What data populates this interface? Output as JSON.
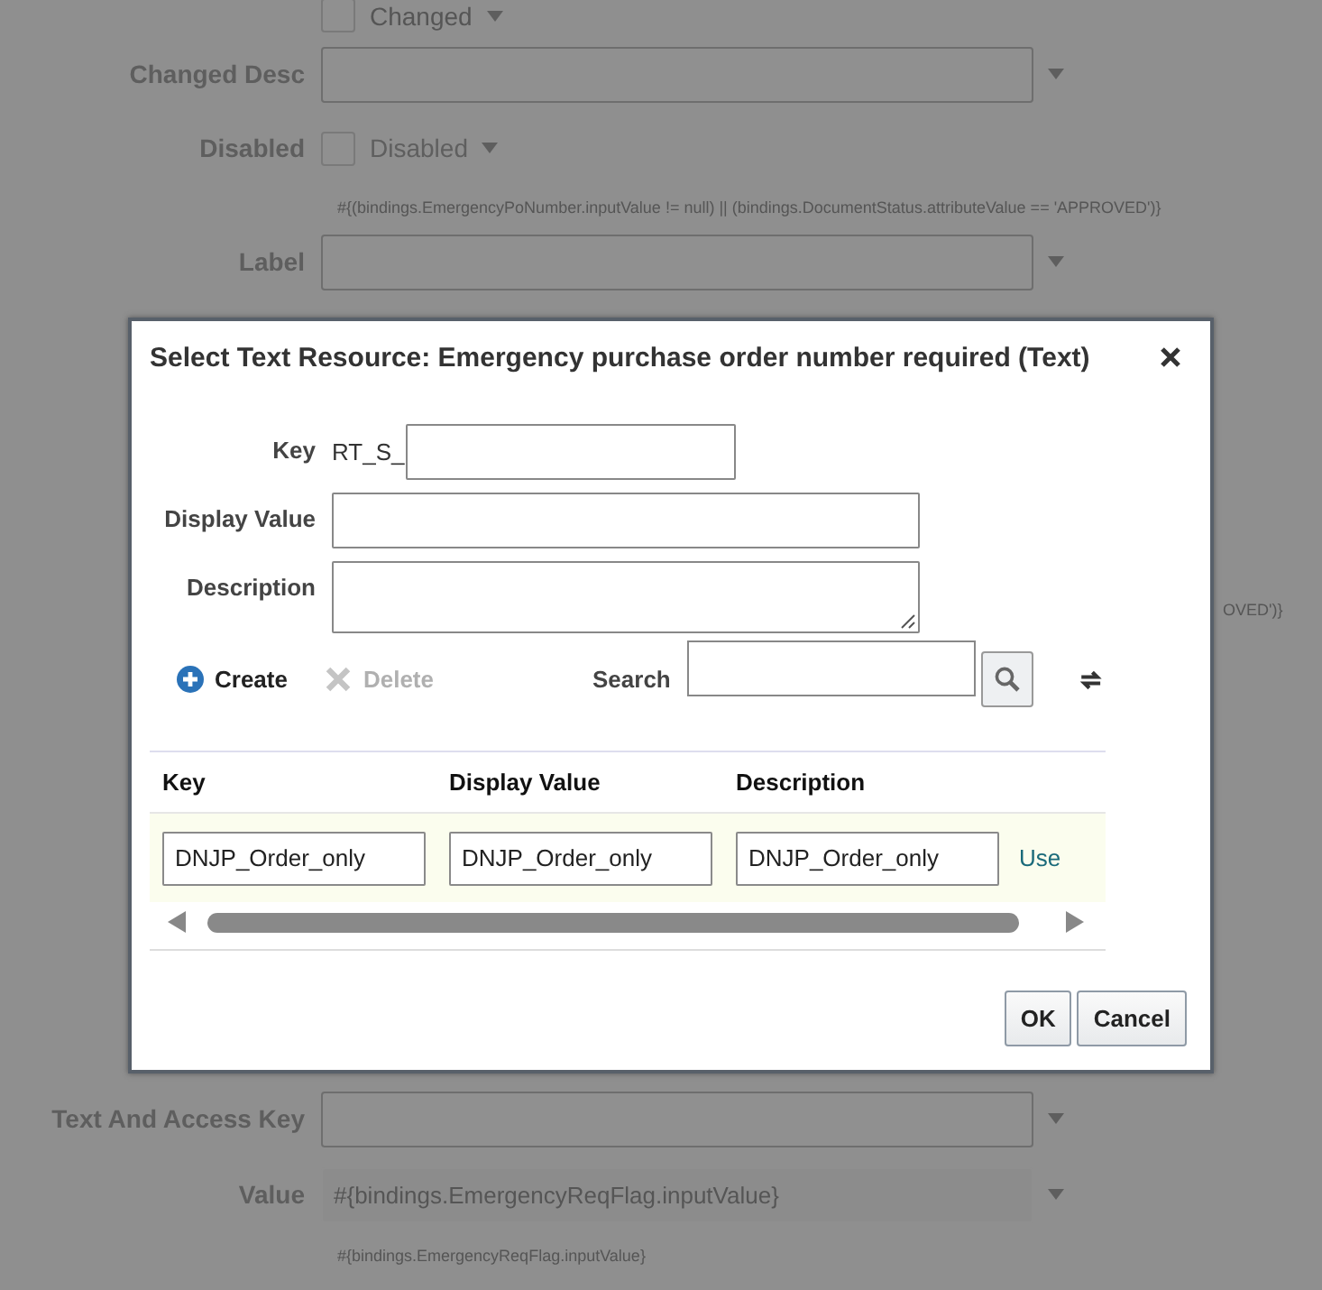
{
  "background_form": {
    "top_rows": [
      {
        "kind": "checkbox",
        "label": "",
        "text": "Changed",
        "checked": false
      },
      {
        "kind": "select",
        "label": "Changed Desc",
        "value": ""
      },
      {
        "kind": "checkbox",
        "label": "Disabled",
        "text": "Disabled",
        "checked": false
      },
      {
        "kind": "hint",
        "text": "#{(bindings.EmergencyPoNumber.inputValue != null) || (bindings.DocumentStatus.attributeValue == 'APPROVED')}"
      },
      {
        "kind": "select",
        "label": "Label",
        "value": ""
      }
    ],
    "partial_text": "OVED')}",
    "bottom_rows": [
      {
        "kind": "select",
        "label": "Text And Access Key",
        "value": ""
      },
      {
        "kind": "readonly",
        "label": "Value",
        "value": "#{bindings.EmergencyReqFlag.inputValue}"
      },
      {
        "kind": "hint",
        "text": "#{bindings.EmergencyReqFlag.inputValue}"
      }
    ]
  },
  "dialog": {
    "title": "Select Text Resource: Emergency purchase order number required (Text)",
    "fields": [
      {
        "label": "Key",
        "prefix": "RT_S_",
        "kind": "input"
      },
      {
        "label": "Display Value",
        "kind": "input"
      },
      {
        "label": "Description",
        "kind": "textarea"
      }
    ],
    "toolbar": {
      "create": {
        "label": "Create",
        "disabled": false
      },
      "delete": {
        "label": "Delete",
        "disabled": true
      },
      "search_label": "Search"
    },
    "table": {
      "columns": [
        "Key",
        "Display Value",
        "Description"
      ],
      "rows": [
        {
          "cells": [
            "DNJP_Order_only",
            "DNJP_Order_only",
            "DNJP_Order_only"
          ],
          "action": "Use",
          "selected": true
        }
      ]
    },
    "buttons": [
      "OK",
      "Cancel"
    ]
  }
}
